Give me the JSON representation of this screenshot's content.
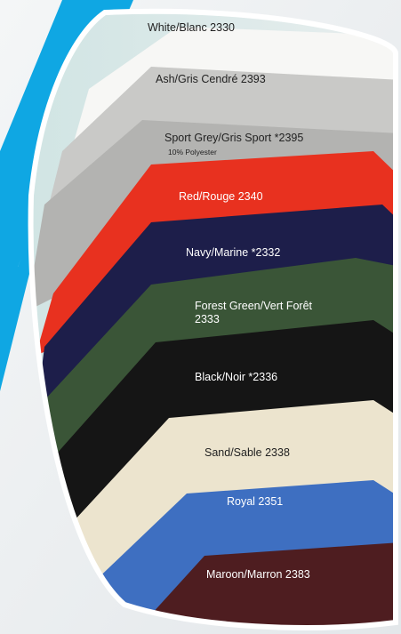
{
  "colors": {
    "accent_blue": "#0fa7e3",
    "white": "#f7f7f5",
    "ash": "#c9c9c7",
    "sport_grey": "#b3b3b1",
    "red": "#e8311f",
    "navy": "#1d1e4a",
    "forest_green": "#3a5537",
    "black": "#151515",
    "sand": "#ece4ce",
    "royal": "#3e6fc1",
    "maroon": "#4e1d20"
  },
  "swatches": [
    {
      "name": "White/Blanc 2330",
      "text_color": "#222222"
    },
    {
      "name": "Ash/Gris Cendré 2393",
      "text_color": "#222222"
    },
    {
      "name": "Sport Grey/Gris Sport *2395",
      "note": "10% Polyester",
      "text_color": "#222222"
    },
    {
      "name": "Red/Rouge 2340",
      "text_color": "#ffffff"
    },
    {
      "name": "Navy/Marine *2332",
      "text_color": "#ffffff"
    },
    {
      "name": "Forest Green/Vert Forêt",
      "name_line2": "2333",
      "text_color": "#ffffff"
    },
    {
      "name": "Black/Noir *2336",
      "text_color": "#ffffff"
    },
    {
      "name": "Sand/Sable 2338",
      "text_color": "#222222"
    },
    {
      "name": "Royal 2351",
      "text_color": "#ffffff"
    },
    {
      "name": "Maroon/Marron 2383",
      "text_color": "#ffffff"
    }
  ]
}
